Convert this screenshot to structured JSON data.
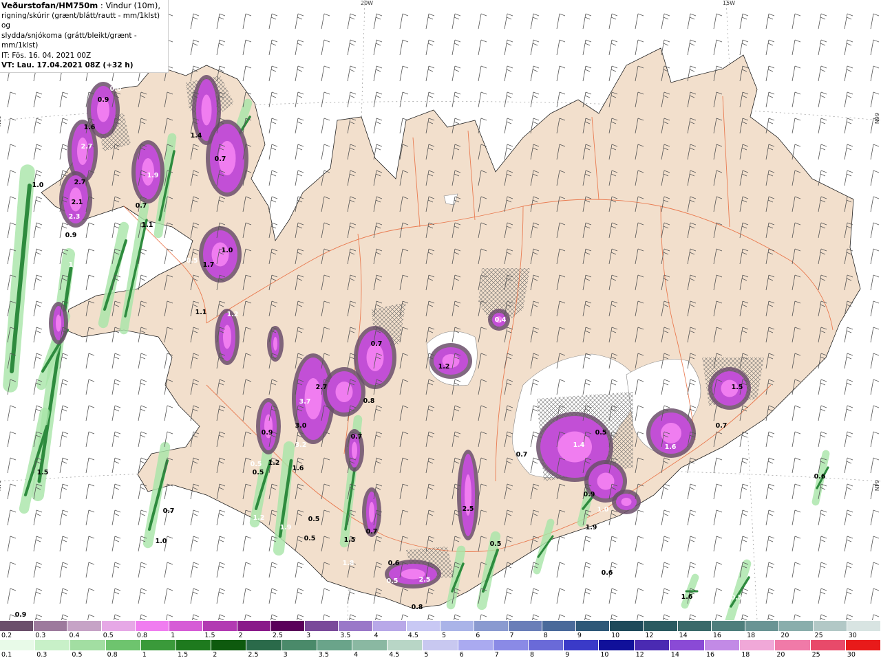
{
  "header": {
    "model": "Veðurstofan/HM750m",
    "line1_rest": " : Vindur (10m),",
    "line2": "rigning/skúrir (grænt/blátt/rautt - mm/1klst) og",
    "line3": "slydda/snjókoma (grátt/bleikt/grænt - mm/1klst)",
    "line4": "IT: Fös. 16. 04. 2021 00Z",
    "line5": "VT: Lau. 17.04.2021 08Z (+32 h)"
  },
  "grid_labels": {
    "lon": [
      "20W",
      "15W"
    ],
    "lat": [
      "66N",
      "64N"
    ]
  },
  "colors": {
    "land": "#f2dfcc",
    "sea": "#ffffff",
    "roads": "#e86a3c",
    "snow_precip": "#c24fd6",
    "rain_precip": "#2e8b3e",
    "light_rain": "#bff0bf"
  },
  "precip_labels": [
    {
      "t": "0.6"
    },
    {
      "t": "0.9"
    },
    {
      "t": "1.6"
    },
    {
      "t": "2.7"
    },
    {
      "t": "2.7"
    },
    {
      "t": "2.1"
    },
    {
      "t": "2.3"
    },
    {
      "t": "0.9"
    },
    {
      "t": "1.0"
    },
    {
      "t": "1.3"
    },
    {
      "t": "1.4"
    },
    {
      "t": "0.7"
    },
    {
      "t": "1.9"
    },
    {
      "t": "0.7"
    },
    {
      "t": "1.1"
    },
    {
      "t": "0.5"
    },
    {
      "t": "1.7"
    },
    {
      "t": "1.0"
    },
    {
      "t": "1.2"
    },
    {
      "t": "1.1"
    },
    {
      "t": "0.7"
    },
    {
      "t": "3.7"
    },
    {
      "t": "2.7"
    },
    {
      "t": "3.0"
    },
    {
      "t": "3.2"
    },
    {
      "t": "1.6"
    },
    {
      "t": "0.9"
    },
    {
      "t": "0.5"
    },
    {
      "t": "1.2"
    },
    {
      "t": "0.5"
    },
    {
      "t": "1.2"
    },
    {
      "t": "0.7"
    },
    {
      "t": "0.5"
    },
    {
      "t": "1.9"
    },
    {
      "t": "0.5"
    },
    {
      "t": "1.5"
    },
    {
      "t": "1.8"
    },
    {
      "t": "0.7"
    },
    {
      "t": "0.7"
    },
    {
      "t": "0.5"
    },
    {
      "t": "0.8"
    },
    {
      "t": "1.2"
    },
    {
      "t": "0.4"
    },
    {
      "t": "2.5"
    },
    {
      "t": "0.6"
    },
    {
      "t": "2.5"
    },
    {
      "t": "0.8"
    },
    {
      "t": "0.5"
    },
    {
      "t": "1.4"
    },
    {
      "t": "0.5"
    },
    {
      "t": "0.9"
    },
    {
      "t": "1.0"
    },
    {
      "t": "1.9"
    },
    {
      "t": "0.7"
    },
    {
      "t": "1.6"
    },
    {
      "t": "0.7"
    },
    {
      "t": "0.6"
    },
    {
      "t": "0.6"
    },
    {
      "t": "0.6"
    },
    {
      "t": "1.5"
    },
    {
      "t": "0.5"
    },
    {
      "t": "1.6"
    },
    {
      "t": "1.0"
    },
    {
      "t": "0.6"
    },
    {
      "t": "0.9"
    },
    {
      "t": "1.5"
    }
  ],
  "legend_snow": {
    "labels": [
      "0.2",
      "0.3",
      "0.4",
      "0.5",
      "0.8",
      "1",
      "1.5",
      "2",
      "2.5",
      "3",
      "3.5",
      "4",
      "4.5",
      "5",
      "6",
      "7",
      "8",
      "9",
      "10",
      "12",
      "14",
      "16",
      "18",
      "20",
      "25",
      "30"
    ],
    "colors": [
      "#6b4f6b",
      "#9d7a9d",
      "#c6a3c6",
      "#e6a8e6",
      "#f07df0",
      "#d65cd6",
      "#b23ab2",
      "#8a1a8a",
      "#5a005a",
      "#7a4a9a",
      "#9a78c8",
      "#b8a8e8",
      "#c8c8f4",
      "#aab4e8",
      "#8a9ad0",
      "#6a7eb8",
      "#4a6a9a",
      "#2e5878",
      "#1e4a5a",
      "#2a5a60",
      "#3a6a6a",
      "#4e7e7c",
      "#6a9494",
      "#8aaeac",
      "#b2c8c6",
      "#d8e4e2"
    ]
  },
  "legend_rain": {
    "labels": [
      "0.1",
      "0.3",
      "0.5",
      "0.8",
      "1",
      "1.5",
      "2",
      "2.5",
      "3",
      "3.5",
      "4",
      "4.5",
      "5",
      "6",
      "7",
      "8",
      "9",
      "10",
      "12",
      "14",
      "16",
      "18",
      "20",
      "25",
      "30"
    ],
    "colors": [
      "#e8fae8",
      "#c8f0c8",
      "#a2dea2",
      "#6ec46e",
      "#3a9a3a",
      "#1e7a1e",
      "#0e5a0e",
      "#2a6a4a",
      "#4a8a6a",
      "#6aa48a",
      "#8ab8a2",
      "#b8d6c6",
      "#c8c8f0",
      "#aaaaf0",
      "#8a8ae6",
      "#6a6ad8",
      "#3a3ac8",
      "#10109a",
      "#4a2ab2",
      "#8a4ad6",
      "#c28ae6",
      "#f0a8d8",
      "#f07aa8",
      "#e84a6a",
      "#e81a1a"
    ]
  }
}
